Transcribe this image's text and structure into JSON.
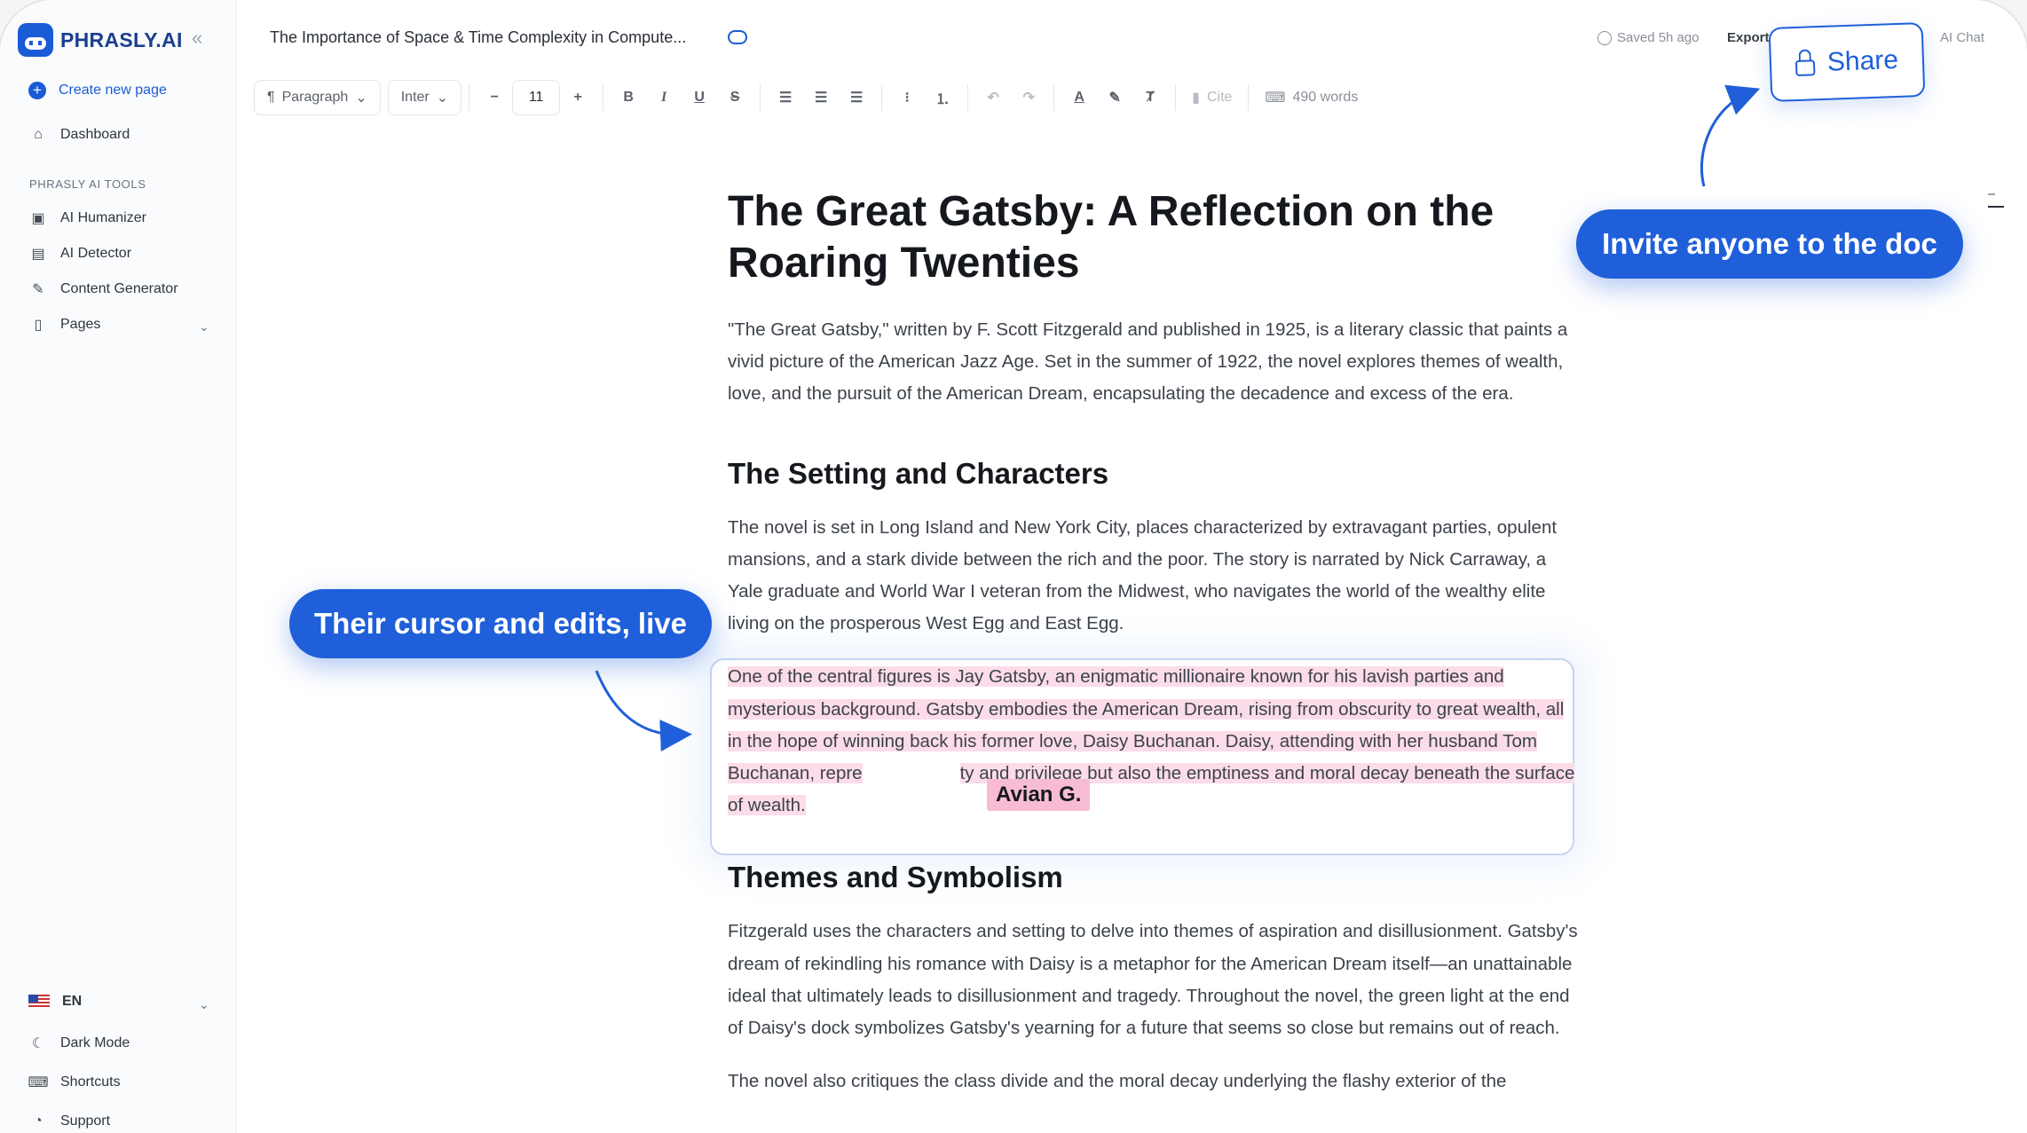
{
  "app": {
    "logo_text": "PHRASLY.AI"
  },
  "sidebar": {
    "create_label": "Create new page",
    "dashboard_label": "Dashboard",
    "section_label": "PHRASLY AI TOOLS",
    "tools": [
      {
        "label": "AI Humanizer",
        "icon": "robot-icon"
      },
      {
        "label": "AI Detector",
        "icon": "doc-search-icon"
      },
      {
        "label": "Content Generator",
        "icon": "pencil-icon"
      },
      {
        "label": "Pages",
        "icon": "page-icon"
      }
    ],
    "language": "EN",
    "dark_mode_label": "Dark Mode",
    "shortcuts_label": "Shortcuts",
    "support_label": "Support"
  },
  "header": {
    "doc_title": "The Importance of Space & Time Complexity in Compute...",
    "saved_text": "Saved 5h ago",
    "export_label": "Export",
    "ai_chat_label": "AI Chat",
    "share_label": "Share"
  },
  "toolbar": {
    "paragraph_label": "Paragraph",
    "font_label": "Inter",
    "font_size": "11",
    "cite_label": "Cite",
    "word_count": "490 words"
  },
  "document": {
    "title": "The Great Gatsby: A Reflection on the Roaring Twenties",
    "intro": "\"The Great Gatsby,\" written by F. Scott Fitzgerald and published in 1925, is a literary classic that paints a vivid picture of the American Jazz Age. Set in the summer of 1922, the novel explores themes of wealth, love, and the pursuit of the American Dream, encapsulating the decadence and excess of the era.",
    "heading_setting": "The Setting and Characters",
    "setting_para": "The novel is set in Long Island and New York City, places characterized by extravagant parties, opulent mansions, and a stark divide between the rich and the poor. The story is narrated by Nick Carraway, a Yale graduate and World War I veteran from the Midwest, who navigates the world of the wealthy elite living on the prosperous West Egg and East Egg.",
    "highlighted_para_a": "One of the central figures is Jay Gatsby, an enigmatic millionaire known for his lavish parties and mysterious background. Gatsby embodies the American Dream, rising from obscurity to great wealth, all in the hope of winning back his former love, Daisy Buchanan. Daisy, attending with her husband Tom Buchanan, repre",
    "highlighted_para_b": "ty and privilege but also the emptiness and moral decay beneath the surface of wealth.",
    "heading_themes": "Themes and Symbolism",
    "themes_para": "Fitzgerald uses the characters and setting to delve into themes of aspiration and disillusionment. Gatsby's dream of rekindling his romance with Daisy is a metaphor for the American Dream itself—an unattainable ideal that ultimately leads to disillusionment and tragedy. Throughout the novel, the green light at the end of Daisy's dock symbolizes Gatsby's yearning for a future that seems so close but remains out of reach.",
    "last_para": "The novel also critiques the class divide and the moral decay underlying the flashy exterior of the"
  },
  "collaborator": {
    "name": "Avian G."
  },
  "callouts": {
    "left": "Their cursor and edits, live",
    "right": "Invite anyone to the doc"
  },
  "colors": {
    "accent": "#1f5fd9",
    "highlight": "#fbdce8",
    "cursor_tag": "#f7bcd3"
  }
}
